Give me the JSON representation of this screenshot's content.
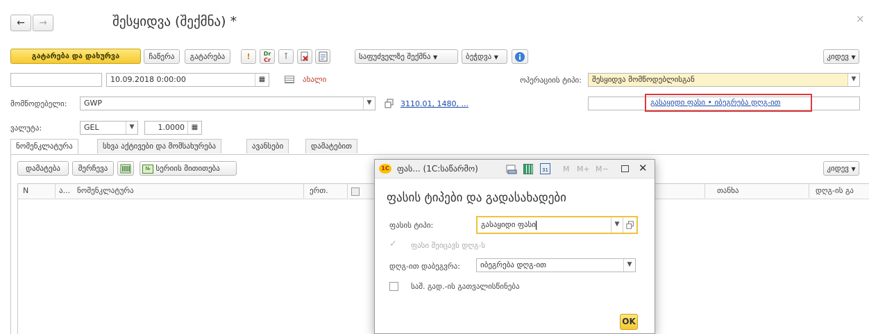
{
  "window": {
    "title": "შესყიდვა (შექმნა) *",
    "close": "×"
  },
  "nav": {
    "back": "←",
    "forward": "→"
  },
  "toolbar": {
    "post_close": "გატარება და დახურვა",
    "save": "ჩაწერა",
    "post": "გატარება",
    "dr": "Dr",
    "cr": "Cr",
    "create_based": "საფუძველზე შექმნა",
    "print": "ბეჭდვა",
    "more": "კიდევ"
  },
  "header": {
    "number_value": "",
    "date_value": "10.09.2018 0:00:00",
    "status_new": "ახალი",
    "op_type_label": "ოპერაციის ტიპი:",
    "op_type_value": "შესყიდვა მომწოდებლისგან",
    "supplier_label": "მომწოდებელი:",
    "supplier_value": "GWP",
    "contract_link": "3110.01, 1480, ...",
    "price_link": "გასაყიდი ფასი • იბეგრება დღგ-ით",
    "currency_label": "ვალუტა:",
    "currency_value": "GEL",
    "rate_value": "1.0000"
  },
  "tabs": [
    {
      "label": "ნომენკლატურა"
    },
    {
      "label": "სხვა აქტივები და მომსახურება"
    },
    {
      "label": "ავანსები"
    },
    {
      "label": "დამატებით"
    }
  ],
  "table_toolbar": {
    "add": "დამატება",
    "pick": "შერჩევა",
    "serial": "სერიის მითითება",
    "more": "კიდევ"
  },
  "table": {
    "columns": [
      "N",
      "ა...",
      "ნომენკლატურა",
      "ერთ.",
      "თანხა",
      "დღგ-ის გა"
    ]
  },
  "dialog": {
    "title": "ფას... (1C:საწარმო)",
    "heading": "ფასის ტიპები და გადასახადები",
    "price_type_label": "ფასის ტიპი:",
    "price_type_value": "გასაყიდი ფასი",
    "vat_included_label": "ფასი შეიცავს დღგ-ს",
    "vat_taxation_label": "დღგ-ით დაბეგვრა:",
    "vat_taxation_value": "იბეგრება დღგ-ით",
    "excise_label": "საშ. გად.-ის გათვალისწინება",
    "ok": "OK",
    "m": "M",
    "mplus": "M+",
    "mminus": "M−",
    "cal_day": "31"
  },
  "colors": {
    "accent_yellow": "#f5c931",
    "link_blue": "#1a4aa8",
    "highlight_red": "#e0373a",
    "optype_bg": "#fdf3c8"
  }
}
